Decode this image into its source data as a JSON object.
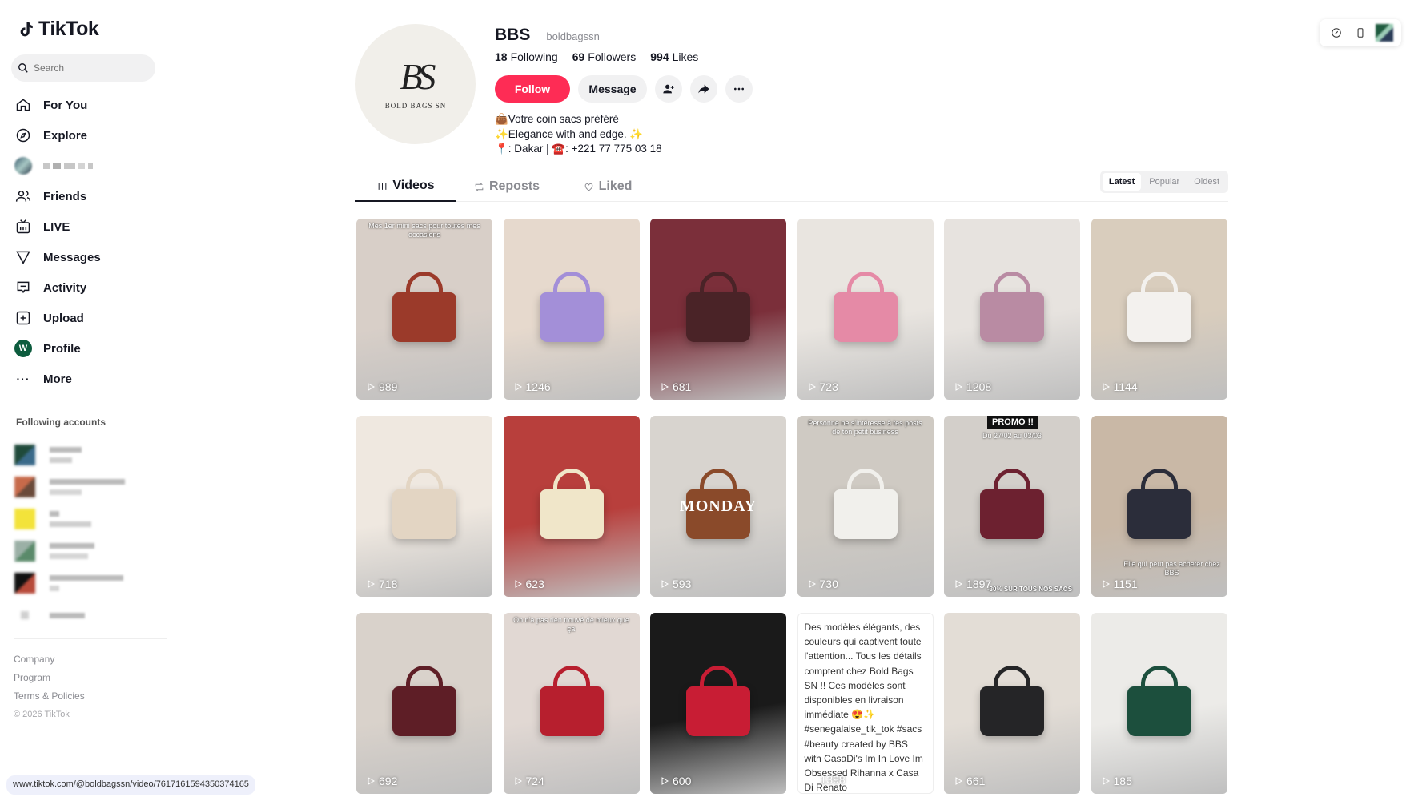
{
  "brand": {
    "name": "TikTok"
  },
  "search": {
    "placeholder": "Search"
  },
  "nav": {
    "items": [
      {
        "label": "For You",
        "icon": "home-icon"
      },
      {
        "label": "Explore",
        "icon": "compass-icon"
      },
      {
        "label": "Friends",
        "icon": "friends-icon"
      },
      {
        "label": "LIVE",
        "icon": "live-icon"
      },
      {
        "label": "Messages",
        "icon": "messages-icon"
      },
      {
        "label": "Activity",
        "icon": "activity-icon"
      },
      {
        "label": "Upload",
        "icon": "upload-icon"
      },
      {
        "label": "Profile",
        "icon": "profile-avatar"
      },
      {
        "label": "More",
        "icon": "more-icon"
      }
    ],
    "profile_avatar_letter": "W"
  },
  "following_section": {
    "title": "Following accounts"
  },
  "footer": {
    "links": [
      "Company",
      "Program",
      "Terms & Policies"
    ],
    "copyright": "© 2026 TikTok"
  },
  "status_url": "www.tiktok.com/@boldbagssn/video/7617161594350374165",
  "profile": {
    "display_name": "BBS",
    "handle": "boldbagssn",
    "monogram": "BS",
    "brand_text": "BOLD BAGS SN",
    "following_count": "18",
    "following_label": "Following",
    "followers_count": "69",
    "followers_label": "Followers",
    "likes_count": "994",
    "likes_label": "Likes",
    "follow_label": "Follow",
    "message_label": "Message",
    "bio": [
      "👜Votre coin sacs préféré",
      "✨Elegance with and edge. ✨",
      "📍: Dakar | ☎️: +221 77 775 03 18"
    ]
  },
  "tabs": [
    {
      "label": "Videos",
      "icon": "grid-icon"
    },
    {
      "label": "Reposts",
      "icon": "repost-icon"
    },
    {
      "label": "Liked",
      "icon": "heart-icon"
    }
  ],
  "sort": {
    "options": [
      "Latest",
      "Popular",
      "Oldest"
    ],
    "selected": "Latest"
  },
  "videos": [
    {
      "views": "989",
      "caption": "Mes 1er mini sacs pour toutes mes occasions",
      "bg": "#d8cfc8",
      "bag": "#9b3a2a"
    },
    {
      "views": "1246",
      "caption": "",
      "bg": "#e6d9cd",
      "bag": "#a38fd8"
    },
    {
      "views": "681",
      "caption": "",
      "bg": "#7b2f3a",
      "bag": "#4a2327"
    },
    {
      "views": "723",
      "caption": "",
      "bg": "#e9e5e0",
      "bag": "#e58aa6"
    },
    {
      "views": "1208",
      "caption": "",
      "bg": "#e7e3df",
      "bag": "#b98ba3"
    },
    {
      "views": "1144",
      "caption": "",
      "bg": "#d9cdbd",
      "bag": "#f3f1ee"
    },
    {
      "views": "718",
      "caption": "",
      "bg": "#efe8e0",
      "bag": "#e3d5c3"
    },
    {
      "views": "623",
      "caption": "",
      "bg": "#b83f3c",
      "bag": "#f0e6c9"
    },
    {
      "views": "593",
      "caption": "",
      "bg": "#d8d4cf",
      "bag": "#8a4a2a"
    },
    {
      "views": "730",
      "caption": "Personne ne s'intéresse à tes posts de ton petit business",
      "bg": "#cfcac3",
      "bag": "#f1f0ec"
    },
    {
      "views": "1897",
      "caption": "",
      "bg": "#d3cfca",
      "bag": "#6d2130"
    },
    {
      "views": "1151",
      "caption": "",
      "bg": "#c9b8a6",
      "bag": "#2b2d3a"
    },
    {
      "views": "692",
      "caption": "",
      "bg": "#d9d2cb",
      "bag": "#5e1e26"
    },
    {
      "views": "724",
      "caption": "",
      "bg": "#e1d8d3",
      "bag": "#b71f2e"
    },
    {
      "views": "600",
      "caption": "",
      "bg": "#1a1a1a",
      "bag": "#c81d34"
    },
    {
      "views": "1398",
      "caption": "",
      "bg": "#ffffff",
      "bag": "#ffffff"
    },
    {
      "views": "661",
      "caption": "",
      "bg": "#e3ddd6",
      "bag": "#252527"
    },
    {
      "views": "185",
      "caption": "",
      "bg": "#ecebe8",
      "bag": "#1c4f3d"
    }
  ],
  "video_text_post": "Des modèles élégants, des couleurs qui captivent toute l'attention... Tous les détails comptent chez Bold Bags SN !! Ces modèles sont disponibles en livraison immédiate 😍✨ #senegalaise_tik_tok #sacs #beauty created by BBS with CasaDi's Im In Love Im Obsessed Rihanna x Casa Di Renato",
  "overlays": {
    "promo": "PROMO !!",
    "promo_dates": "Du 27/02 au 03/03",
    "promo_sub": "-30% SUR TOUS NOS SACS",
    "monday": "MONDAY",
    "red_caption": "On n'a pas rien trouvé de mieux que ça",
    "portrait_caption": "Elle qui peut pas acheter chez BBS"
  },
  "colors": {
    "accent": "#fe2c55",
    "text": "#161823",
    "muted": "#8a8b91"
  }
}
